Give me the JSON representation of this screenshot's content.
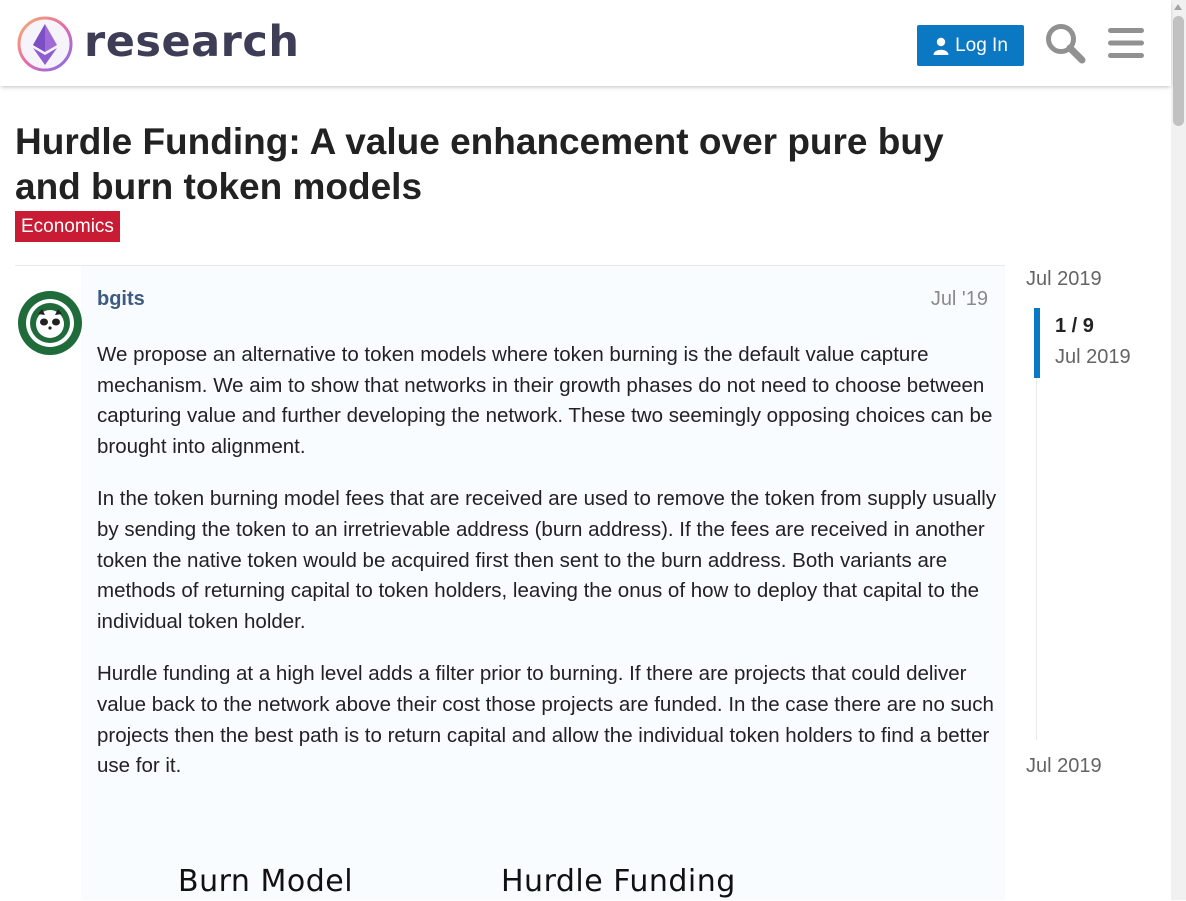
{
  "header": {
    "site_name": "research",
    "login_label": "Log In"
  },
  "topic": {
    "title": "Hurdle Funding: A value enhancement over pure buy and burn token models",
    "category": "Economics",
    "category_color": "#c91b33"
  },
  "post": {
    "username": "bgits",
    "date": "Jul '19",
    "paragraphs": [
      "We propose an alternative to token models where token burning is the default value capture mechanism. We aim to show that networks in their growth phases do not need to choose between capturing value and further developing the network. These two seemingly opposing choices can be brought into alignment.",
      "In the token burning model fees that are received are used to remove the token from supply usually by sending the token to an irretrievable address (burn address). If the fees are received in another token the native token would be acquired first then sent to the burn address. Both variants are methods of returning capital to token holders, leaving the onus of how to deploy that capital to the individual token holder.",
      "Hurdle funding at a high level adds a filter prior to burning. If there are projects that could deliver value back to the network above their cost those projects are funded. In the case there are no such projects then the best path is to return capital and allow the individual token holders to find a better use for it."
    ],
    "image_labels": [
      "Burn Model",
      "Hurdle Funding"
    ]
  },
  "timeline": {
    "start_date": "Jul 2019",
    "position": "1 / 9",
    "position_date": "Jul 2019",
    "end_date": "Jul 2019"
  },
  "colors": {
    "primary": "#0b78c3",
    "username": "#3d5a80"
  }
}
